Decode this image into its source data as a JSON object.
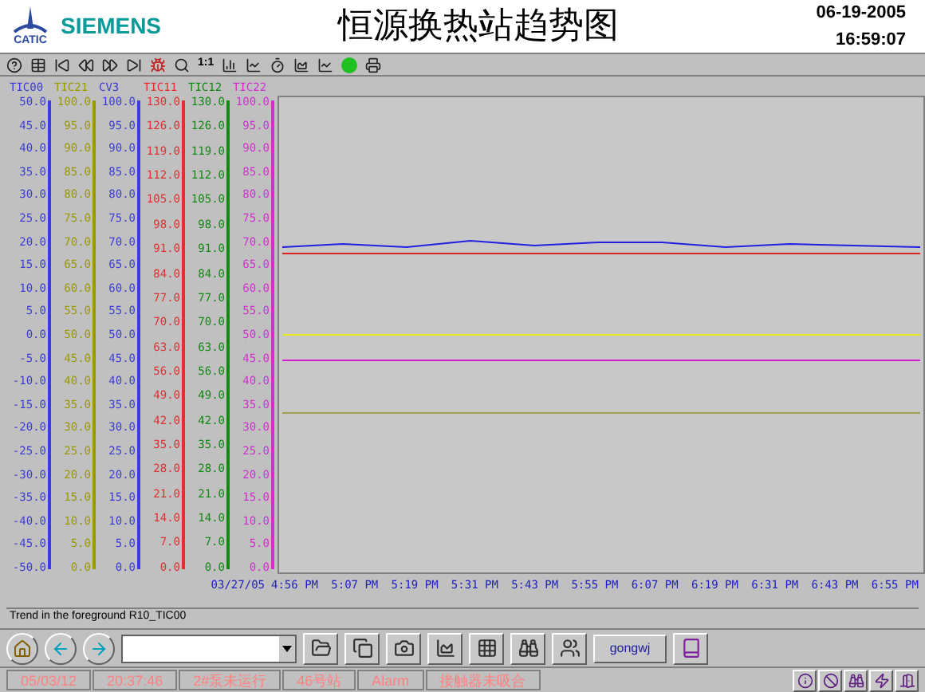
{
  "header": {
    "logo_text": "CATIC",
    "brand": "SIEMENS",
    "title": "恒源换热站趋势图",
    "date": "06-19-2005",
    "time": "16:59:07"
  },
  "toolbar": {
    "zoom_label": "1:1"
  },
  "axes": [
    {
      "name": "TIC00",
      "color": "#3c3cd8",
      "ticks": [
        "50.0",
        "45.0",
        "40.0",
        "35.0",
        "30.0",
        "25.0",
        "20.0",
        "15.0",
        "10.0",
        "5.0",
        "0.0",
        "-5.0",
        "-10.0",
        "-15.0",
        "-20.0",
        "-25.0",
        "-30.0",
        "-35.0",
        "-40.0",
        "-45.0",
        "-50.0"
      ]
    },
    {
      "name": "TIC21",
      "color": "#9a9a00",
      "ticks": [
        "100.0",
        "95.0",
        "90.0",
        "85.0",
        "80.0",
        "75.0",
        "70.0",
        "65.0",
        "60.0",
        "55.0",
        "50.0",
        "45.0",
        "40.0",
        "35.0",
        "30.0",
        "25.0",
        "20.0",
        "15.0",
        "10.0",
        "5.0",
        "0.0"
      ]
    },
    {
      "name": "CV3",
      "color": "#3c3cd8",
      "ticks": [
        "100.0",
        "95.0",
        "90.0",
        "85.0",
        "80.0",
        "75.0",
        "70.0",
        "65.0",
        "60.0",
        "55.0",
        "50.0",
        "45.0",
        "40.0",
        "35.0",
        "30.0",
        "25.0",
        "20.0",
        "15.0",
        "10.0",
        "5.0",
        "0.0"
      ]
    },
    {
      "name": "TIC11",
      "color": "#e03030",
      "ticks": [
        "130.0",
        "126.0",
        "119.0",
        "112.0",
        "105.0",
        "98.0",
        "91.0",
        "84.0",
        "77.0",
        "70.0",
        "63.0",
        "56.0",
        "49.0",
        "42.0",
        "35.0",
        "28.0",
        "21.0",
        "14.0",
        "7.0",
        "0.0"
      ]
    },
    {
      "name": "TIC12",
      "color": "#108a10",
      "ticks": [
        "130.0",
        "126.0",
        "119.0",
        "112.0",
        "105.0",
        "98.0",
        "91.0",
        "84.0",
        "77.0",
        "70.0",
        "63.0",
        "56.0",
        "49.0",
        "42.0",
        "35.0",
        "28.0",
        "21.0",
        "14.0",
        "7.0",
        "0.0"
      ]
    },
    {
      "name": "TIC22",
      "color": "#d030d0",
      "ticks": [
        "100.0",
        "95.0",
        "90.0",
        "85.0",
        "80.0",
        "75.0",
        "70.0",
        "65.0",
        "60.0",
        "55.0",
        "50.0",
        "45.0",
        "40.0",
        "35.0",
        "30.0",
        "25.0",
        "20.0",
        "15.0",
        "10.0",
        "5.0",
        "0.0"
      ]
    }
  ],
  "trend": {
    "date": "03/27/05",
    "time_labels": [
      "4:56 PM",
      "5:07 PM",
      "5:19 PM",
      "5:31 PM",
      "5:43 PM",
      "5:55 PM",
      "6:07 PM",
      "6:19 PM",
      "6:31 PM",
      "6:43 PM",
      "6:55 PM"
    ]
  },
  "status_line": "Trend in the foreground R10_TIC00",
  "user_button": "gongwj",
  "status_bar": [
    "05/03/12",
    "20:37:46",
    "2#泵未运行",
    "46号站",
    "Alarm",
    "接触器未吸合"
  ]
}
